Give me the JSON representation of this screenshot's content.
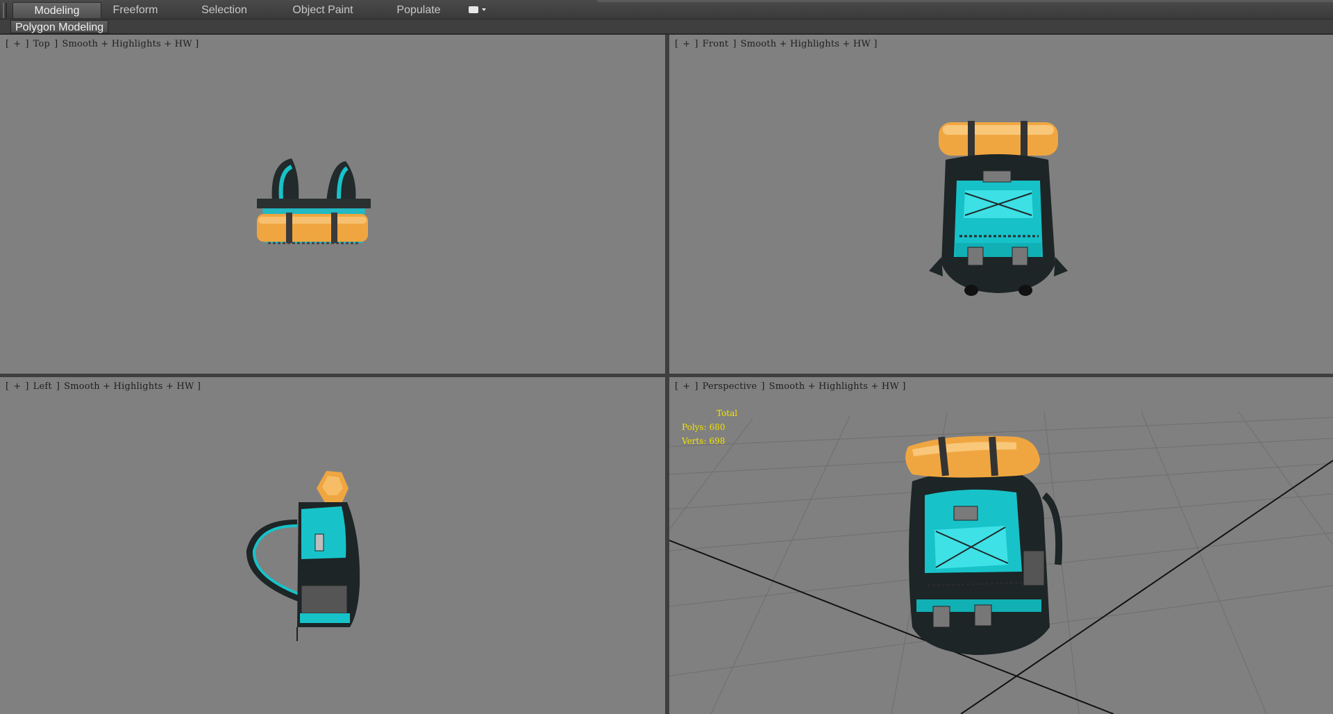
{
  "ribbon": {
    "tabs": [
      {
        "label": "Modeling",
        "active": true
      },
      {
        "label": "Freeform",
        "active": false
      },
      {
        "label": "Selection",
        "active": false
      },
      {
        "label": "Object Paint",
        "active": false
      },
      {
        "label": "Populate",
        "active": false
      }
    ],
    "panel_button": "Polygon Modeling"
  },
  "viewports": {
    "top": {
      "bracket_open": "[",
      "plus": "+",
      "sep": "]",
      "view": "Top",
      "shading": "Smooth + Highlights + HW ]"
    },
    "front": {
      "bracket_open": "[",
      "plus": "+",
      "sep": "]",
      "view": "Front",
      "shading": "Smooth + Highlights + HW ]"
    },
    "left": {
      "bracket_open": "[",
      "plus": "+",
      "sep": "]",
      "view": "Left",
      "shading": "Smooth + Highlights + HW ]"
    },
    "persp": {
      "bracket_open": "[",
      "plus": "+",
      "sep": "]",
      "view": "Perspective",
      "shading": "Smooth + Highlights + HW ]"
    }
  },
  "stats": {
    "total_label": "Total",
    "polys_label": "Polys:",
    "polys_value": "680",
    "verts_label": "Verts:",
    "verts_value": "698"
  },
  "colors": {
    "viewport_bg": "#808080",
    "stats_text": "#f3e200",
    "model_teal": "#17c3c9",
    "model_orange": "#f0a640",
    "model_dark": "#222a2c"
  }
}
